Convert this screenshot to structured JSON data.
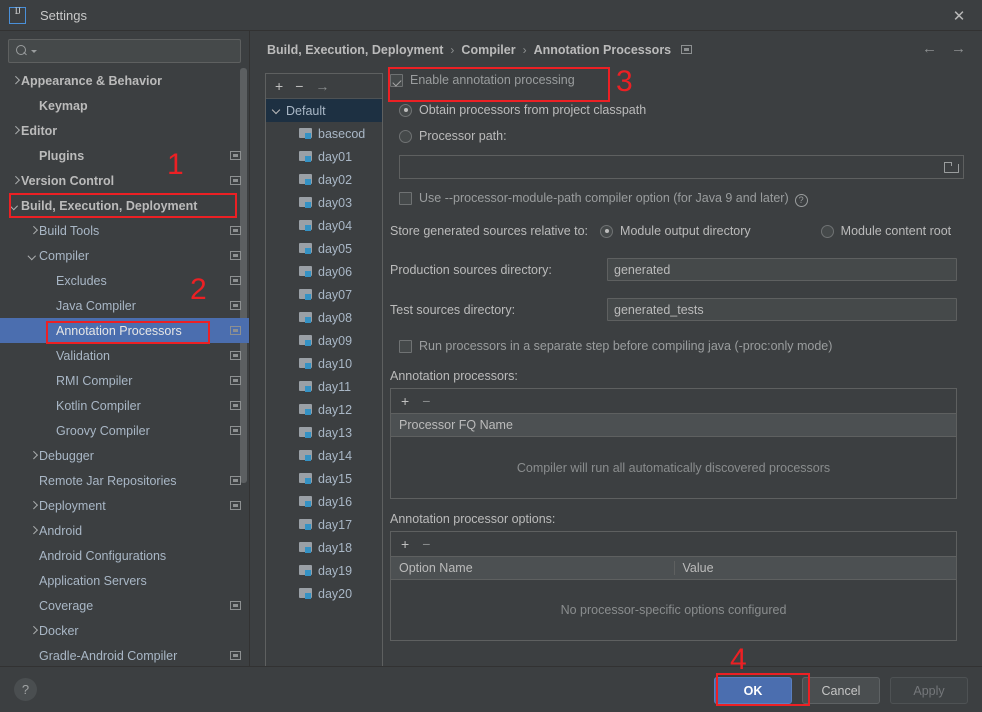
{
  "window": {
    "title": "Settings",
    "logo_icon": "intellij-idea-logo-icon",
    "close_icon": "close-icon"
  },
  "search": {
    "placeholder": "",
    "value": "",
    "icon": "search-icon"
  },
  "sidebar": {
    "items": [
      {
        "label": "Appearance & Behavior",
        "indent": 0,
        "arrow": "closed",
        "bold": true,
        "badge": false,
        "selected": false
      },
      {
        "label": "Keymap",
        "indent": 1,
        "arrow": "none",
        "bold": true,
        "badge": false,
        "selected": false
      },
      {
        "label": "Editor",
        "indent": 0,
        "arrow": "closed",
        "bold": true,
        "badge": false,
        "selected": false
      },
      {
        "label": "Plugins",
        "indent": 1,
        "arrow": "none",
        "bold": true,
        "badge": true,
        "selected": false
      },
      {
        "label": "Version Control",
        "indent": 0,
        "arrow": "closed",
        "bold": true,
        "badge": true,
        "selected": false
      },
      {
        "label": "Build, Execution, Deployment",
        "indent": 0,
        "arrow": "open",
        "bold": true,
        "badge": false,
        "selected": false
      },
      {
        "label": "Build Tools",
        "indent": 1,
        "arrow": "closed",
        "bold": false,
        "badge": true,
        "selected": false
      },
      {
        "label": "Compiler",
        "indent": 1,
        "arrow": "open",
        "bold": false,
        "badge": true,
        "selected": false
      },
      {
        "label": "Excludes",
        "indent": 2,
        "arrow": "none",
        "bold": false,
        "badge": true,
        "selected": false
      },
      {
        "label": "Java Compiler",
        "indent": 2,
        "arrow": "none",
        "bold": false,
        "badge": true,
        "selected": false
      },
      {
        "label": "Annotation Processors",
        "indent": 2,
        "arrow": "none",
        "bold": false,
        "badge": true,
        "selected": true
      },
      {
        "label": "Validation",
        "indent": 2,
        "arrow": "none",
        "bold": false,
        "badge": true,
        "selected": false
      },
      {
        "label": "RMI Compiler",
        "indent": 2,
        "arrow": "none",
        "bold": false,
        "badge": true,
        "selected": false
      },
      {
        "label": "Kotlin Compiler",
        "indent": 2,
        "arrow": "none",
        "bold": false,
        "badge": true,
        "selected": false
      },
      {
        "label": "Groovy Compiler",
        "indent": 2,
        "arrow": "none",
        "bold": false,
        "badge": true,
        "selected": false
      },
      {
        "label": "Debugger",
        "indent": 1,
        "arrow": "closed",
        "bold": false,
        "badge": false,
        "selected": false
      },
      {
        "label": "Remote Jar Repositories",
        "indent": 1,
        "arrow": "none",
        "bold": false,
        "badge": true,
        "selected": false
      },
      {
        "label": "Deployment",
        "indent": 1,
        "arrow": "closed",
        "bold": false,
        "badge": true,
        "selected": false
      },
      {
        "label": "Android",
        "indent": 1,
        "arrow": "closed",
        "bold": false,
        "badge": false,
        "selected": false
      },
      {
        "label": "Android Configurations",
        "indent": 1,
        "arrow": "none",
        "bold": false,
        "badge": false,
        "selected": false
      },
      {
        "label": "Application Servers",
        "indent": 1,
        "arrow": "none",
        "bold": false,
        "badge": false,
        "selected": false
      },
      {
        "label": "Coverage",
        "indent": 1,
        "arrow": "none",
        "bold": false,
        "badge": true,
        "selected": false
      },
      {
        "label": "Docker",
        "indent": 1,
        "arrow": "closed",
        "bold": false,
        "badge": false,
        "selected": false
      },
      {
        "label": "Gradle-Android Compiler",
        "indent": 1,
        "arrow": "none",
        "bold": false,
        "badge": true,
        "selected": false
      }
    ]
  },
  "breadcrumb": {
    "parts": [
      "Build, Execution, Deployment",
      "Compiler",
      "Annotation Processors"
    ],
    "separator": "›",
    "badge_icon": "project-scope-badge-icon"
  },
  "nav": {
    "back_icon": "arrow-left-icon",
    "forward_icon": "arrow-right-icon"
  },
  "module_panel": {
    "toolbar": {
      "add": "+",
      "remove": "−",
      "move": "→"
    },
    "root": {
      "label": "Default",
      "selected": true
    },
    "modules": [
      "basecod",
      "day01",
      "day02",
      "day03",
      "day04",
      "day05",
      "day06",
      "day07",
      "day08",
      "day09",
      "day10",
      "day11",
      "day12",
      "day13",
      "day14",
      "day15",
      "day16",
      "day17",
      "day18",
      "day19",
      "day20"
    ]
  },
  "form": {
    "enable_annotation_processing": {
      "label": "Enable annotation processing",
      "checked": true
    },
    "processor_source": {
      "options": [
        {
          "label": "Obtain processors from project classpath",
          "selected": true
        },
        {
          "label": "Processor path:",
          "selected": false
        }
      ],
      "path_value": "",
      "browse_icon": "folder-browse-icon"
    },
    "use_processor_module_path": {
      "label": "Use --processor-module-path compiler option (for Java 9 and later)",
      "checked": false,
      "help_icon": "help-question-icon"
    },
    "store_generated": {
      "label": "Store generated sources relative to:",
      "options": [
        {
          "label": "Module output directory",
          "selected": true
        },
        {
          "label": "Module content root",
          "selected": false
        }
      ]
    },
    "production_sources": {
      "label": "Production sources directory:",
      "value": "generated"
    },
    "test_sources": {
      "label": "Test sources directory:",
      "value": "generated_tests"
    },
    "run_separate_step": {
      "label": "Run processors in a separate step before compiling java (-proc:only mode)",
      "checked": false
    },
    "processors_table": {
      "label": "Annotation processors:",
      "toolbar": {
        "add": "+",
        "remove": "−"
      },
      "columns": [
        "Processor FQ Name"
      ],
      "rows": [],
      "empty_text": "Compiler will run all automatically discovered processors"
    },
    "options_table": {
      "label": "Annotation processor options:",
      "toolbar": {
        "add": "+",
        "remove": "−"
      },
      "columns": [
        "Option Name",
        "Value"
      ],
      "rows": [],
      "empty_text": "No processor-specific options configured"
    }
  },
  "footer": {
    "help_label": "?",
    "ok_label": "OK",
    "cancel_label": "Cancel",
    "apply_label": "Apply"
  },
  "annotations": {
    "numbers": [
      "1",
      "2",
      "3",
      "4"
    ],
    "color": "#ec2024"
  }
}
